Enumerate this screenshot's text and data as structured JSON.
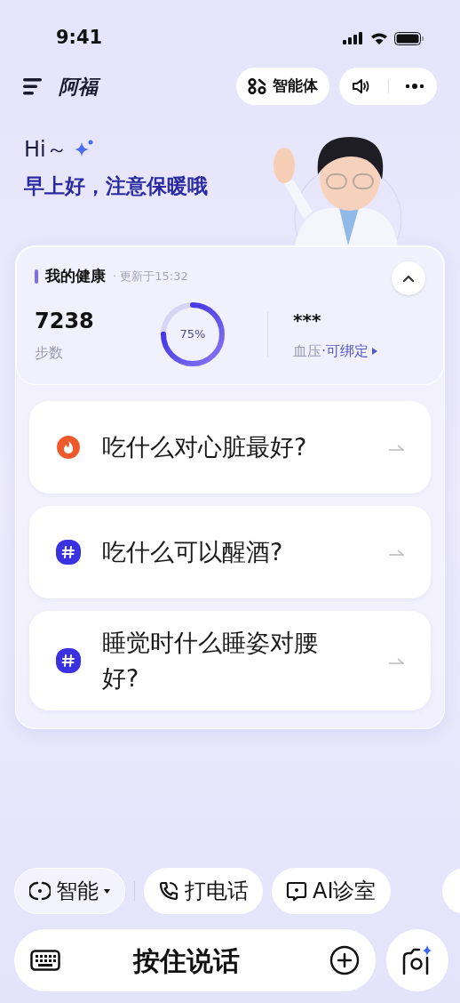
{
  "status_bar": {
    "time": "9:41"
  },
  "header": {
    "title": "阿福",
    "agent_button": "智能体"
  },
  "greeting": {
    "hi": "Hi～",
    "message": "早上好，注意保暖哦"
  },
  "health": {
    "title": "我的健康",
    "updated": "· 更新于15:32",
    "expanded": true,
    "steps": {
      "value": "7238",
      "label": "步数"
    },
    "progress": {
      "level": 0.75,
      "reading": "75%"
    },
    "blood_pressure": {
      "value": "***",
      "label": "血压",
      "link": "·可绑定"
    }
  },
  "questions": [
    {
      "kind": "hot",
      "text": "吃什么对心脏最好?"
    },
    {
      "kind": "topic",
      "text": "吃什么可以醒酒?"
    },
    {
      "kind": "topic",
      "text": "睡觉时什么睡姿对腰好?"
    }
  ],
  "chips": [
    {
      "kind": "mode",
      "label": "智能"
    },
    {
      "kind": "phone",
      "label": "打电话"
    },
    {
      "kind": "clinic",
      "label": "AI诊室"
    }
  ],
  "voice_bar": {
    "label": "按住说话"
  }
}
